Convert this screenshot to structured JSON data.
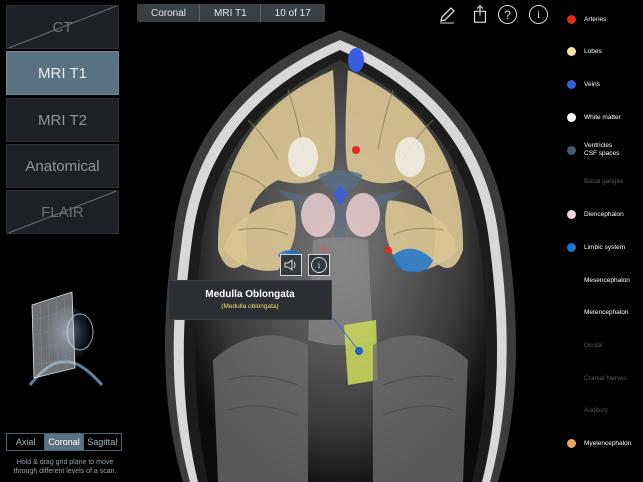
{
  "modalities": [
    {
      "label": "CT",
      "state": "disabled"
    },
    {
      "label": "MRI T1",
      "state": "active"
    },
    {
      "label": "MRI T2",
      "state": "normal"
    },
    {
      "label": "Anatomical",
      "state": "normal"
    },
    {
      "label": "FLAIR",
      "state": "disabled"
    }
  ],
  "view_tabs": [
    "Axial",
    "Coronal",
    "Sagittal"
  ],
  "active_view": "Coronal",
  "hint": "Hold & drag grid plane to move through different levels of a scan.",
  "breadcrumb": {
    "view": "Coronal",
    "modality": "MRI T1",
    "slice": "10 of 17"
  },
  "toolbar_icons": [
    "pencil-icon",
    "share-icon",
    "help-icon",
    "info-icon"
  ],
  "toolbar_labels": {
    "help": "?",
    "info": "i"
  },
  "legend": [
    {
      "label": "Arteries",
      "color": "#e02a1f",
      "active": true
    },
    {
      "label": "Lobes",
      "color": "#f3e2a6",
      "active": true
    },
    {
      "label": "Veins",
      "color": "#3a5ce0",
      "active": true
    },
    {
      "label": "White matter",
      "color": "#ffffff",
      "active": true
    },
    {
      "label": "Ventricles\nCSF spaces",
      "color": "#4a5a6e",
      "active": true
    },
    {
      "label": "Basal ganglia",
      "color": null,
      "active": false
    },
    {
      "label": "Diencephalon",
      "color": "#f2d3d6",
      "active": true
    },
    {
      "label": "Limbic system",
      "color": "#1e74c8",
      "active": true
    },
    {
      "label": "Mesencephalon",
      "color": null,
      "active": true
    },
    {
      "label": "Metencephalon",
      "color": null,
      "active": true
    },
    {
      "label": "Ocular",
      "color": null,
      "active": false
    },
    {
      "label": "Cranial Nerves",
      "color": null,
      "active": false
    },
    {
      "label": "Auditory",
      "color": null,
      "active": false
    },
    {
      "label": "Myelencephalon",
      "color": "#f0a560",
      "active": true
    }
  ],
  "tooltip": {
    "title": "Medulla Oblongata",
    "subtitle": "(Medulla oblongata)"
  },
  "tooltip_buttons": {
    "info": "i"
  },
  "colors": {
    "accent": "#5b7282",
    "lobes": "#d9c595",
    "medulla": "#c7d45a"
  }
}
